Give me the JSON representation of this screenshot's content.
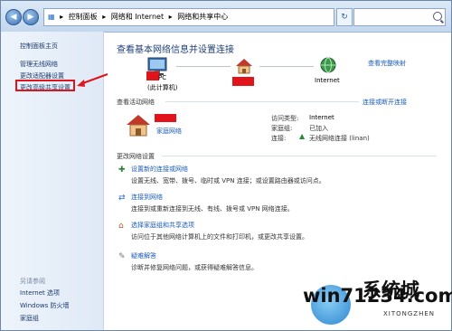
{
  "breadcrumb": {
    "items": [
      "控制面板",
      "网络和 Internet",
      "网络和共享中心"
    ],
    "separators": [
      "▸",
      "▸",
      "▸"
    ]
  },
  "sidebar": {
    "links": [
      "控制面板主页",
      "管理无线网络",
      "更改适配器设置",
      "更改高级共享设置"
    ],
    "see_also_heading": "另请参阅",
    "see_also": [
      "Internet 选项",
      "Windows 防火墙",
      "家庭组"
    ]
  },
  "main": {
    "title": "查看基本网络信息并设置连接",
    "full_map": "查看完整映射",
    "nodes": [
      {
        "label": "PC",
        "sub": "(此计算机)"
      },
      {
        "label": ""
      },
      {
        "label": "Internet"
      }
    ],
    "active_title": "查看活动网络",
    "connect_link": "连接或断开连接",
    "network_type": "家庭网络",
    "access_type_label": "访问类型:",
    "access_type_value": "Internet",
    "homegroup_label": "家庭组:",
    "homegroup_value": "已加入",
    "connection_label": "连接:",
    "connection_value": "无线网络连接 (linan)",
    "change_title": "更改网络设置",
    "tasks": [
      {
        "title": "设置新的连接或网络",
        "desc": "设置无线、宽带、拨号、临时或 VPN 连接；或设置路由器或访问点。"
      },
      {
        "title": "连接到网络",
        "desc": "连接到或重新连接到无线、有线、拨号或 VPN 网络连接。"
      },
      {
        "title": "选择家庭组和共享选项",
        "desc": "访问位于其他网络计算机上的文件和打印机，或更改共享设置。"
      },
      {
        "title": "疑难解答",
        "desc": "诊断并修复网络问题，或获得疑难解答信息。"
      }
    ]
  },
  "watermark": {
    "main": "win71234.com",
    "brand": "系统城",
    "sub": "XITONGZHEN"
  },
  "colors": {
    "accent": "#1a5bb8",
    "highlight": "#e0141a"
  }
}
